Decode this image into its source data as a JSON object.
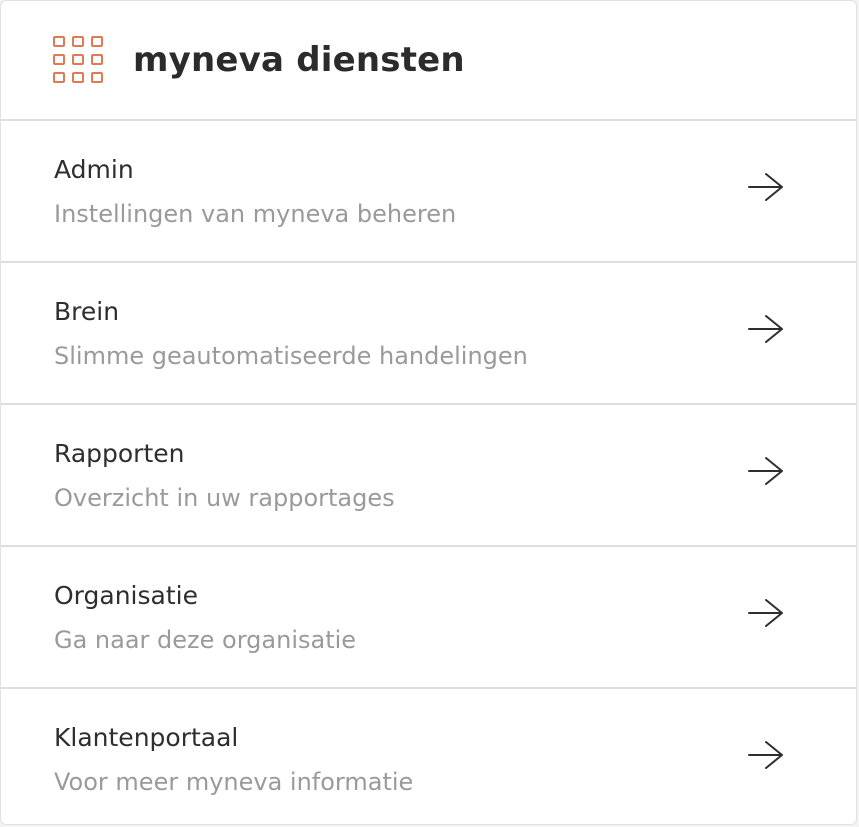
{
  "header": {
    "icon": "apps-grid-icon",
    "title": "myneva diensten",
    "accent_color": "#e07a52"
  },
  "items": [
    {
      "title": "Admin",
      "subtitle": "Instellingen van myneva beheren",
      "icon": "arrow-right-icon"
    },
    {
      "title": "Brein",
      "subtitle": "Slimme geautomatiseerde handelingen",
      "icon": "arrow-right-icon"
    },
    {
      "title": "Rapporten",
      "subtitle": "Overzicht in uw rapportages",
      "icon": "arrow-right-icon"
    },
    {
      "title": "Organisatie",
      "subtitle": "Ga naar deze organisatie",
      "icon": "arrow-right-icon"
    },
    {
      "title": "Klantenportaal",
      "subtitle": "Voor meer myneva informatie",
      "icon": "arrow-right-icon"
    }
  ]
}
